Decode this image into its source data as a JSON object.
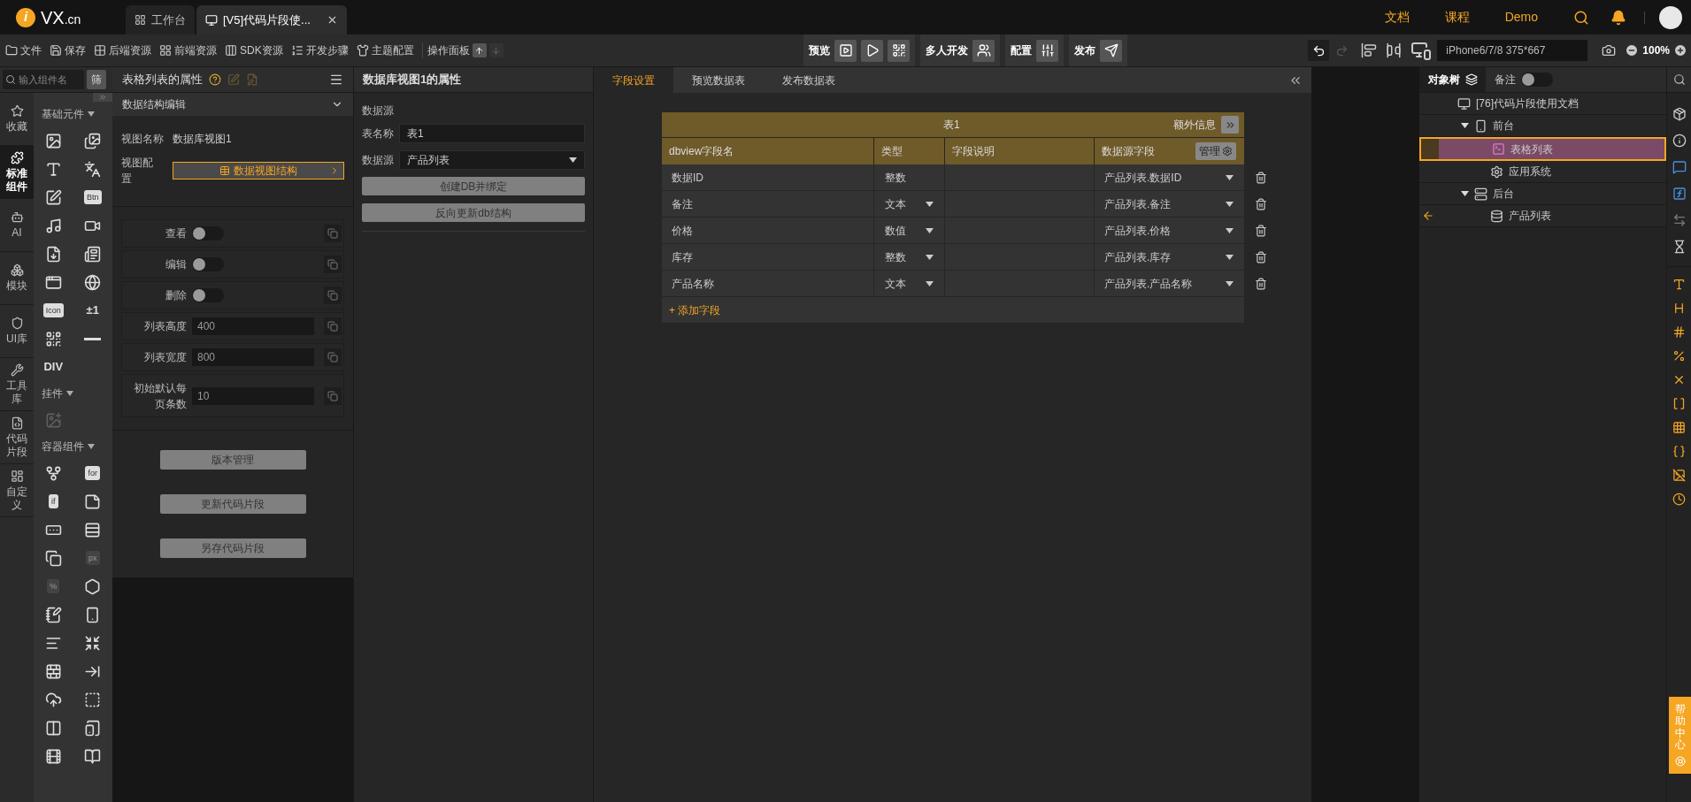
{
  "topbar": {
    "logo_mark": "i",
    "logo": "VX",
    "logo_suffix": ".cn",
    "tabs": [
      {
        "label": "工作台",
        "selected": false,
        "closable": false
      },
      {
        "label": "[V5]代码片段使...",
        "selected": true,
        "closable": true
      }
    ],
    "links": [
      "文档",
      "课程",
      "Demo"
    ]
  },
  "toolbar": {
    "menu": [
      {
        "kind": "file",
        "label": "文件"
      },
      {
        "kind": "save",
        "label": "保存"
      },
      {
        "kind": "backend",
        "label": "后端资源"
      },
      {
        "kind": "frontend",
        "label": "前端资源"
      },
      {
        "kind": "sdk",
        "label": "SDK资源"
      },
      {
        "kind": "steps",
        "label": "开发步骤"
      },
      {
        "kind": "theme",
        "label": "主题配置"
      }
    ],
    "panel_control": {
      "label": "操作面板",
      "can_move_up": true,
      "can_move_down": false
    },
    "groups": [
      {
        "kind": "preview",
        "label": "预览"
      },
      {
        "kind": "team",
        "label": "多人开发"
      },
      {
        "kind": "config",
        "label": "配置"
      },
      {
        "kind": "publish",
        "label": "发布"
      }
    ],
    "history": {
      "can_undo": true,
      "can_redo": false
    },
    "device": "iPhone6/7/8 375*667",
    "zoom": "100%"
  },
  "component_search": {
    "placeholder": "输入组件名",
    "filter_button": "筛"
  },
  "left_nav": [
    {
      "kind": "star",
      "label": "收藏",
      "selected": false
    },
    {
      "kind": "puzzle",
      "label": "标准组件",
      "selected": true
    },
    {
      "kind": "ai",
      "label": "AI",
      "selected": false
    },
    {
      "kind": "modules",
      "label": "模块",
      "selected": false
    },
    {
      "kind": "ui",
      "label": "UI库",
      "selected": false
    },
    {
      "kind": "tools",
      "label": "工具库",
      "selected": false
    },
    {
      "kind": "code",
      "label": "代码片段",
      "selected": false
    },
    {
      "kind": "custom",
      "label": "自定义",
      "selected": false
    }
  ],
  "palette": {
    "sections": [
      {
        "title": "基础元件",
        "items": [
          {
            "kind": "image",
            "disabled": false
          },
          {
            "kind": "gallery",
            "disabled": false
          },
          {
            "kind": "text",
            "disabled": false
          },
          {
            "kind": "translate",
            "disabled": false
          },
          {
            "kind": "edit",
            "disabled": false
          },
          {
            "kind": "tile",
            "label": "Btn",
            "disabled": false
          },
          {
            "kind": "music",
            "disabled": false
          },
          {
            "kind": "video",
            "disabled": false
          },
          {
            "kind": "markdown",
            "disabled": false
          },
          {
            "kind": "doc",
            "disabled": false
          },
          {
            "kind": "window",
            "disabled": false
          },
          {
            "kind": "browser",
            "disabled": false
          },
          {
            "kind": "tile",
            "label": "Icon",
            "disabled": false
          },
          {
            "kind": "label",
            "label": "±1",
            "disabled": false
          },
          {
            "kind": "qr",
            "disabled": false
          },
          {
            "kind": "divider",
            "disabled": false
          },
          {
            "kind": "label",
            "label": "DIV",
            "disabled": false
          }
        ]
      },
      {
        "title": "挂件",
        "items": [
          {
            "kind": "widget",
            "disabled": true
          }
        ]
      },
      {
        "title": "容器组件",
        "items": [
          {
            "kind": "branch",
            "disabled": false
          },
          {
            "kind": "tile",
            "label": "for",
            "disabled": false
          },
          {
            "kind": "tile",
            "label": "if",
            "disabled": false
          },
          {
            "kind": "note",
            "disabled": false
          },
          {
            "kind": "row",
            "disabled": false
          },
          {
            "kind": "column",
            "disabled": false
          },
          {
            "kind": "layers",
            "disabled": false
          },
          {
            "kind": "tile",
            "label": "px",
            "disabled": true
          },
          {
            "kind": "tile",
            "label": "%",
            "disabled": true
          },
          {
            "kind": "hex",
            "disabled": false
          },
          {
            "kind": "editbox",
            "disabled": false
          },
          {
            "kind": "frame",
            "disabled": false
          },
          {
            "kind": "list",
            "disabled": false
          },
          {
            "kind": "shrink",
            "disabled": false
          },
          {
            "kind": "bricks",
            "disabled": false
          },
          {
            "kind": "arrowin",
            "disabled": false
          },
          {
            "kind": "upload",
            "disabled": false
          },
          {
            "kind": "dashed",
            "disabled": false
          },
          {
            "kind": "split",
            "disabled": false
          },
          {
            "kind": "phone",
            "disabled": false
          },
          {
            "kind": "film",
            "disabled": false
          },
          {
            "kind": "book",
            "disabled": false
          }
        ]
      }
    ]
  },
  "properties": {
    "title": "表格列表的属性",
    "section": {
      "title": "数据结构编辑",
      "expanded": true
    },
    "view_name_label": "视图名称",
    "view_name": "数据库视图1",
    "view_config_label": "视图配置",
    "view_config_button": "数据视图结构",
    "settings": [
      {
        "kind": "toggle",
        "label": "查看",
        "on": false
      },
      {
        "kind": "toggle",
        "label": "编辑",
        "on": false
      },
      {
        "kind": "toggle",
        "label": "删除",
        "on": false
      },
      {
        "kind": "input",
        "label": "列表高度",
        "value": "400"
      },
      {
        "kind": "input",
        "label": "列表宽度",
        "value": "800"
      },
      {
        "kind": "input",
        "label": "初始默认每页条数",
        "value": "10"
      }
    ],
    "buttons": [
      "版本管理",
      "更新代码片段",
      "另存代码片段"
    ]
  },
  "db_view": {
    "title": "数据库视图1的属性",
    "source_heading": "数据源",
    "table_name_label": "表名称",
    "table_name": "表1",
    "source_label": "数据源",
    "source": "产品列表",
    "buttons": [
      "创建DB并绑定",
      "反向更新db结构"
    ]
  },
  "editor": {
    "tabs": [
      {
        "label": "字段设置",
        "selected": true
      },
      {
        "label": "预览数据表",
        "selected": false
      },
      {
        "label": "发布数据表",
        "selected": false
      }
    ],
    "table": {
      "title": "表1",
      "extra_label": "额外信息",
      "columns": [
        "dbview字段名",
        "类型",
        "字段说明",
        "数据源字段"
      ],
      "manage_button": "管理",
      "rows": [
        {
          "name": "数据ID",
          "type": "整数",
          "type_editable": false,
          "source": "产品列表.数据ID"
        },
        {
          "name": "备注",
          "type": "文本",
          "type_editable": true,
          "source": "产品列表.备注"
        },
        {
          "name": "价格",
          "type": "数值",
          "type_editable": true,
          "source": "产品列表.价格"
        },
        {
          "name": "库存",
          "type": "整数",
          "type_editable": true,
          "source": "产品列表.库存"
        },
        {
          "name": "产品名称",
          "type": "文本",
          "type_editable": true,
          "source": "产品列表.产品名称"
        }
      ],
      "add_label": "+ 添加字段"
    }
  },
  "object_tree": {
    "tabs": [
      {
        "label": "对象树",
        "selected": true
      }
    ],
    "notes": {
      "label": "备注",
      "on": false
    },
    "nodes": [
      {
        "kind": "app",
        "label": "[76]代码片段使用文档",
        "selected": false,
        "children": [
          {
            "kind": "phone",
            "label": "前台",
            "expanded": true,
            "selected": false,
            "children": [
              {
                "kind": "code",
                "label": "表格列表",
                "selected": true,
                "referenced": false
              },
              {
                "kind": "gear",
                "label": "应用系统",
                "selected": false,
                "referenced": false
              }
            ]
          },
          {
            "kind": "server",
            "label": "后台",
            "expanded": true,
            "selected": false,
            "children": [
              {
                "kind": "database",
                "label": "产品列表",
                "selected": false,
                "referenced": true
              }
            ]
          }
        ]
      }
    ]
  },
  "help": {
    "label": "帮助中心"
  }
}
